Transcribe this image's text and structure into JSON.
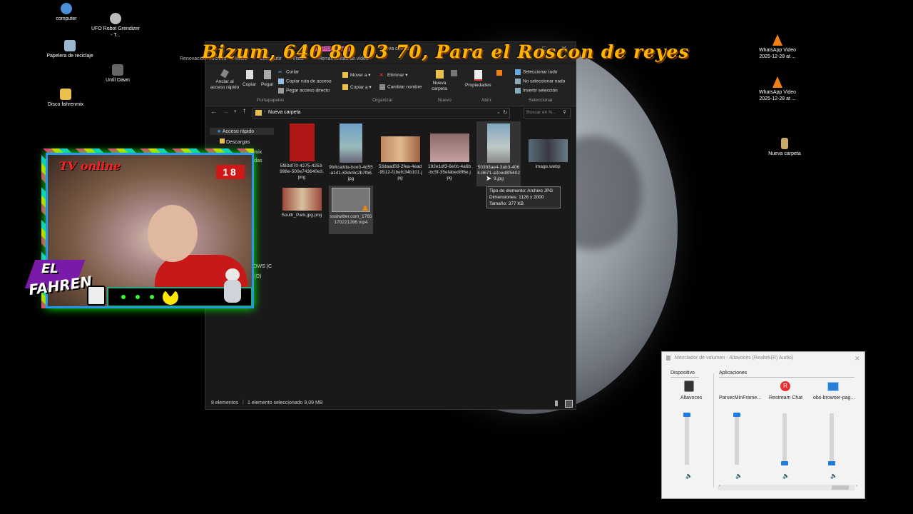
{
  "banner": {
    "text": "Bizum, 640 80 03 70,  Para el Roscon de reyes"
  },
  "desktop": {
    "icons_left": [
      {
        "label": "computer"
      },
      {
        "label": "UFO Robot Grendizer - T..."
      },
      {
        "label": "Papelera de reciclaje"
      },
      {
        "label": "Until Dawn"
      },
      {
        "label": "Disco fahrenmix"
      }
    ],
    "icons_right": [
      {
        "label": "WhatsApp Video 2025-12-28 at ..."
      },
      {
        "label": "WhatsApp Video 2025-12-28 at ..."
      },
      {
        "label": "Nueva carpeta"
      }
    ]
  },
  "explorer": {
    "title": "Nueva carpeta",
    "title_tabs": [
      "Renovación",
      "Archivo",
      "Inicio",
      "Compartir",
      "Vista",
      "Herramientas de vídeo"
    ],
    "context_tab": "Reproducir",
    "ribbon": {
      "portapapeles": {
        "anclar": "Anclar al acceso rápido",
        "copiar": "Copiar",
        "pegar": "Pegar",
        "cortar": "Cortar",
        "copiar_ruta": "Copiar ruta de acceso",
        "pegar_acceso": "Pegar acceso directo",
        "group": "Portapapeles"
      },
      "organizar": {
        "mover": "Mover a",
        "copiar_a": "Copiar a",
        "eliminar": "Eliminar",
        "cambiar": "Cambiar nombre",
        "group": "Organizar"
      },
      "nuevo": {
        "nueva_carpeta": "Nueva carpeta",
        "group": "Nuevo"
      },
      "abrir": {
        "propiedades": "Propiedades",
        "group": "Abrir"
      },
      "seleccionar": {
        "todo": "Seleccionar todo",
        "nada": "No seleccionar nada",
        "invertir": "Invertir selección",
        "group": "Seleccionar"
      }
    },
    "address": {
      "path": "Nueva carpeta",
      "search_placeholder": "Buscar en N..."
    },
    "nav": {
      "items": [
        "Acceso rápido",
        "Descargas",
        "Disco fahrenmix",
        "radas",
        "ts",
        "DOWS (C",
        "S (D)"
      ]
    },
    "files": [
      {
        "name": "5f83df70-4275-4253-996e-500e743640e3.png",
        "color": "#b01818"
      },
      {
        "name": "9b8cadda-bce3-4d55-a141-63dc9c2b7fb6.jpg",
        "color": "#6fa0c8"
      },
      {
        "name": "53daad59-2fea-4ead-9512-f1befc34b101.jpg",
        "color": "#c08a60"
      },
      {
        "name": "192e1df3-6e0c-4a6b-bc5f-35efabed8f6e.jpg",
        "color": "#8a6a68"
      },
      {
        "name": "50393ae4-3ab3-4064-8671-a3ced8f54029.jpg",
        "color": "#7fa6c0"
      },
      {
        "name": "image.webp",
        "color": "#5a6b78"
      },
      {
        "name": "South_Park.jpg.png",
        "color": "#9c4a3a"
      },
      {
        "name": "ssstwitter.com_1765170221286.mp4",
        "color": "#777777"
      }
    ],
    "tooltip": {
      "type": "Tipo de elemento: Archivo JPG",
      "dims": "Dimensiones: 1126 x 2000",
      "size": "Tamaño: 377 KB"
    },
    "status": {
      "count": "8 elementos",
      "selected": "1 elemento seleccionado  9,09 MB"
    }
  },
  "webcam": {
    "title": "TV online",
    "rating": "18",
    "logo_line1": "EL",
    "logo_line2": "FAHREN"
  },
  "mixer": {
    "title": "Mezclador de volumen - Altavoces (Realtek(R) Audio)",
    "device_header": "Dispositivo",
    "apps_header": "Aplicaciones",
    "channels": [
      {
        "label": "Altavoces",
        "level": 1.0
      },
      {
        "label": "ParsecMinFrame...",
        "level": 1.0
      },
      {
        "label": "Restream Chat",
        "level": 0.0
      },
      {
        "label": "obs-browser-pag...",
        "level": 0.0
      }
    ]
  }
}
